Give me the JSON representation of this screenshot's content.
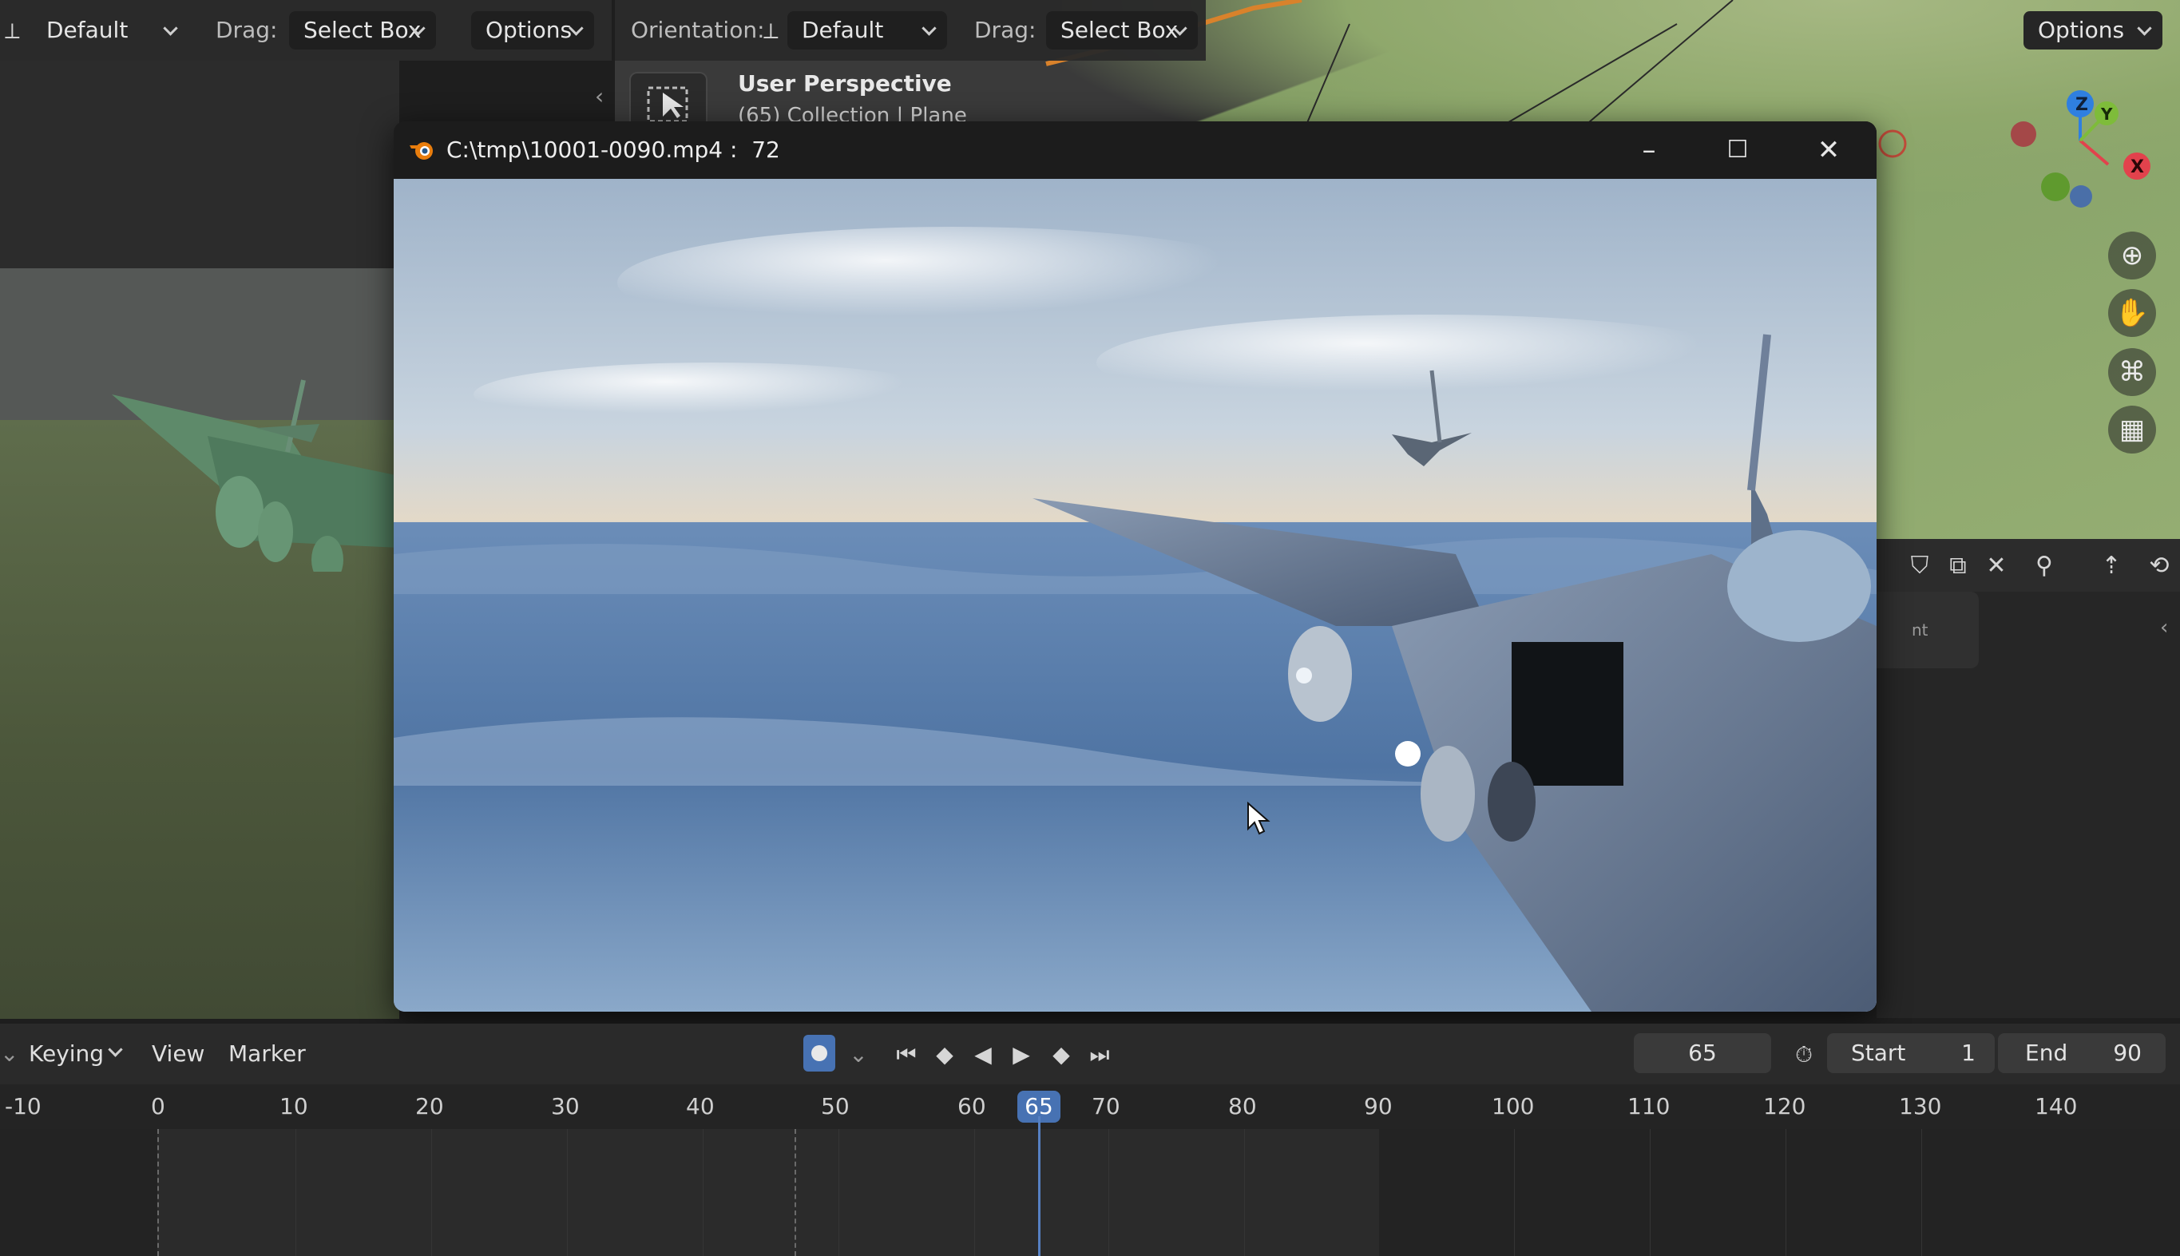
{
  "left_header": {
    "orientation_value": "Default",
    "drag_label": "Drag:",
    "drag_value": "Select Box",
    "options_label": "Options"
  },
  "right_header": {
    "orientation_label": "Orientation:",
    "orientation_value": "Default",
    "drag_label": "Drag:",
    "drag_value": "Select Box",
    "options_label": "Options"
  },
  "viewport": {
    "title": "User Perspective",
    "subtitle": "(65) Collection | Plane",
    "gizmo": {
      "z": "Z",
      "y": "Y",
      "x": "X"
    }
  },
  "video_window": {
    "title": "C:\\tmp\\10001-0090.mp4 :  72",
    "minimize": "–",
    "maximize": "☐",
    "close": "✕"
  },
  "properties_panel": {
    "card_text": "nt"
  },
  "timeline": {
    "menus": [
      "Keying",
      "View",
      "Marker"
    ],
    "current_frame": "65",
    "start_label": "Start",
    "start_value": "1",
    "end_label": "End",
    "end_value": "90",
    "ruler": [
      "-10",
      "0",
      "10",
      "20",
      "30",
      "40",
      "50",
      "60",
      "65",
      "70",
      "80",
      "90",
      "100",
      "110",
      "120",
      "130",
      "140"
    ]
  },
  "colors": {
    "accent_blue": "#4772b3",
    "playhead": "#5680c2",
    "axis_x": "#e2424c",
    "axis_y": "#7ebc3a",
    "axis_z": "#2f7fe0"
  },
  "icons": [
    "blender-icon",
    "transform-pivot-icon",
    "select-box-icon",
    "zoom-icon",
    "hand-pan-icon",
    "camera-view-icon",
    "grid-ortho-icon",
    "record-icon",
    "jump-start-icon",
    "prev-keyframe-icon",
    "play-reverse-icon",
    "play-icon",
    "next-keyframe-icon",
    "jump-end-icon",
    "stopwatch-icon",
    "pin-icon"
  ]
}
